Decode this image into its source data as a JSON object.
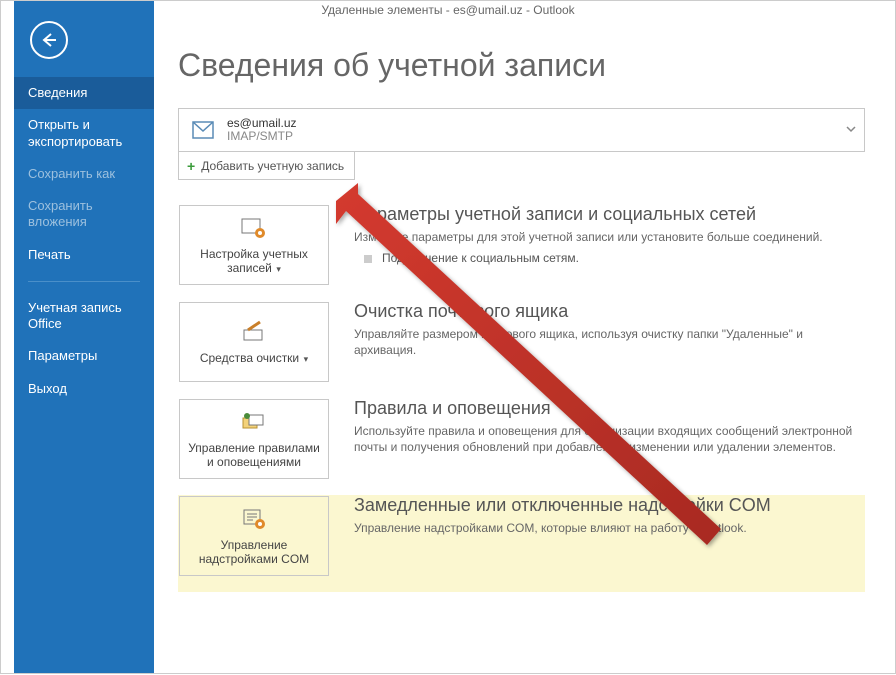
{
  "window": {
    "title": "Удаленные элементы - es@umail.uz - Outlook"
  },
  "sidebar": {
    "items": [
      {
        "label": "Сведения",
        "state": "selected"
      },
      {
        "label": "Открыть и экспортировать",
        "state": "normal"
      },
      {
        "label": "Сохранить как",
        "state": "disabled"
      },
      {
        "label": "Сохранить вложения",
        "state": "disabled"
      },
      {
        "label": "Печать",
        "state": "normal"
      },
      {
        "label": "Учетная запись Office",
        "state": "normal"
      },
      {
        "label": "Параметры",
        "state": "normal"
      },
      {
        "label": "Выход",
        "state": "normal"
      }
    ]
  },
  "page": {
    "heading": "Сведения об учетной записи"
  },
  "account": {
    "email": "es@umail.uz",
    "protocol": "IMAP/SMTP",
    "add_label": "Добавить учетную запись"
  },
  "sections": [
    {
      "button_label": "Настройка учетных записей",
      "has_dropdown": true,
      "title": "Параметры учетной записи и социальных сетей",
      "desc": "Измените параметры для этой учетной записи или установите больше соединений.",
      "bullet": "Подключение к социальным сетям."
    },
    {
      "button_label": "Средства очистки",
      "has_dropdown": true,
      "title": "Очистка почтового ящика",
      "desc": "Управляйте размером почтового ящика, используя очистку папки \"Удаленные\" и архивация."
    },
    {
      "button_label": "Управление правилами и оповещениями",
      "has_dropdown": false,
      "title": "Правила и оповещения",
      "desc": "Используйте правила и оповещения для организации входящих сообщений электронной почты и получения обновлений при добавлении, изменении или удалении элементов."
    },
    {
      "button_label": "Управление надстройками COM",
      "has_dropdown": false,
      "title": "Замедленные или отключенные надстройки COM",
      "desc": "Управление надстройками COM, которые влияют на работу в Outlook.",
      "highlight": true
    }
  ]
}
